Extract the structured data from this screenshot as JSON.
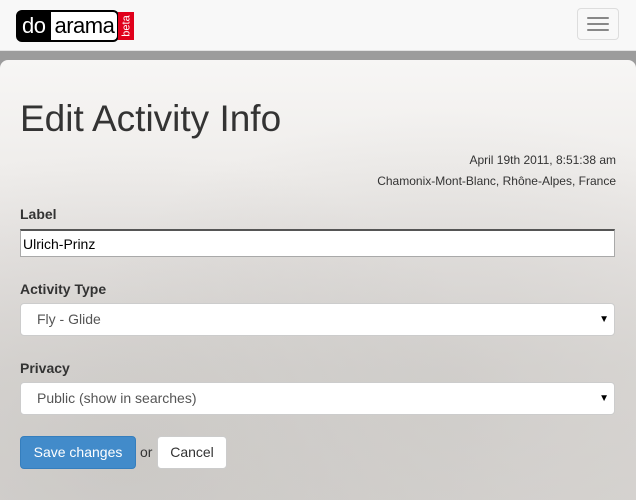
{
  "navbar": {
    "logo": {
      "do": "do",
      "arama": "arama",
      "beta": "beta"
    },
    "menu_icon": "hamburger-icon"
  },
  "page": {
    "title": "Edit Activity Info",
    "date": "April 19th 2011, 8:51:38 am",
    "location": "Chamonix-Mont-Blanc, Rhône-Alpes, France"
  },
  "form": {
    "label_field": {
      "label": "Label",
      "value": "Ulrich-Prinz"
    },
    "activity_type": {
      "label": "Activity Type",
      "selected": "Fly - Glide"
    },
    "privacy": {
      "label": "Privacy",
      "selected": "Public (show in searches)"
    },
    "save_label": "Save changes",
    "or_text": "or",
    "cancel_label": "Cancel"
  },
  "colors": {
    "primary": "#428bca",
    "beta_badge": "#e0001b"
  }
}
